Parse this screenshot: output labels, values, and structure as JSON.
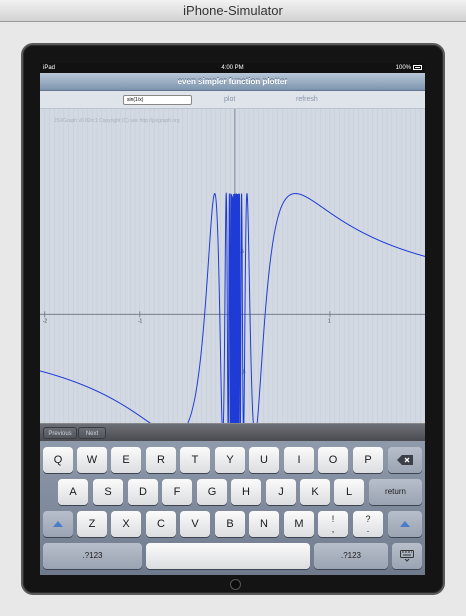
{
  "window": {
    "title": "iPhone-Simulator"
  },
  "status_bar": {
    "carrier": "iPad",
    "time": "4:00 PM",
    "battery": "100%"
  },
  "nav": {
    "title": "even simpler function plotter"
  },
  "toolbar": {
    "function_value": "sin(1/x)",
    "plot_label": "plot",
    "refresh_label": "refresh"
  },
  "plot": {
    "copyright": "JSXGraph v0.82rc1 Copyright (C) see http://jsxgraph.org"
  },
  "chart_data": {
    "type": "line",
    "function": "sin(1/x)",
    "x_ticks": [
      "-2",
      "-1",
      "1"
    ],
    "y_ticks": [
      "0.5",
      "-0.5"
    ],
    "xlim": [
      -2.05,
      2.0
    ],
    "ylim": [
      -0.9,
      1.7
    ],
    "curve_color": "#1f3bd6",
    "series": [
      {
        "values": "sin(1/x)"
      }
    ]
  },
  "accessory": {
    "previous_label": "Previous",
    "next_label": "Next"
  },
  "keyboard": {
    "row1": [
      "Q",
      "W",
      "E",
      "R",
      "T",
      "Y",
      "U",
      "I",
      "O",
      "P"
    ],
    "row2": [
      "A",
      "S",
      "D",
      "F",
      "G",
      "H",
      "J",
      "K",
      "L"
    ],
    "row3": [
      "Z",
      "X",
      "C",
      "V",
      "B",
      "N",
      "M"
    ],
    "return_label": "return",
    "punct1": [
      "!",
      ","
    ],
    "punct2": [
      "?",
      "."
    ],
    "numbers_label": ".?123"
  },
  "colors": {
    "accent": "#4a7cc8",
    "plot_bg": "#d3d9e2",
    "curve": "#1f3bd6"
  }
}
